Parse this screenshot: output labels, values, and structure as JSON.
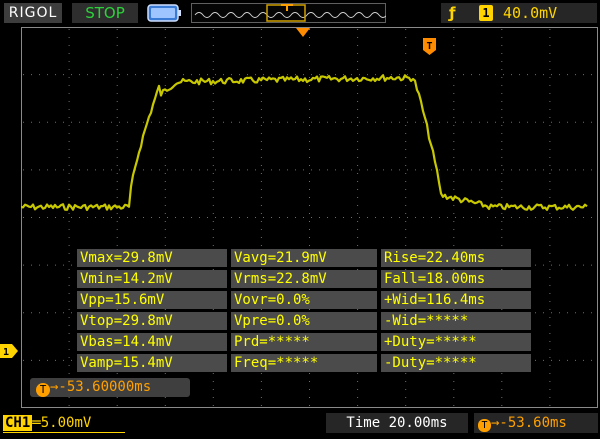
{
  "header": {
    "brand": "RIGOL",
    "run_status": "STOP",
    "trigger_edge_symbol": "ƒ",
    "trigger_channel": "1",
    "trigger_level": "40.0mV"
  },
  "markers": {
    "channel1_label": "1",
    "trigger_badge": "T"
  },
  "measurements": {
    "rows": [
      [
        "Vmax=29.8mV",
        "Vavg=21.9mV",
        "Rise=22.40ms"
      ],
      [
        "Vmin=14.2mV",
        "Vrms=22.8mV",
        "Fall=18.00ms"
      ],
      [
        "Vpp=15.6mV",
        "Vovr=0.0%",
        "+Wid=116.4ms"
      ],
      [
        "Vtop=29.8mV",
        "Vpre=0.0%",
        "-Wid=*****"
      ],
      [
        "Vbas=14.4mV",
        "Prd=*****",
        "+Duty=*****"
      ],
      [
        "Vamp=15.4mV",
        "Freq=*****",
        "-Duty=*****"
      ]
    ]
  },
  "trigger_offset": {
    "icon": "T",
    "value": "→-53.60000ms"
  },
  "footer": {
    "channel_tag": "CH1",
    "channel_coupling": "═",
    "channel_scale": "5.00mV",
    "timebase": "Time 20.00ms",
    "horizontal_offset_icon": "T",
    "horizontal_offset": "→-53.60ms"
  },
  "colors": {
    "trace": "#c8c800",
    "grid": "#8a8a8a",
    "accent_orange": "#ffa000",
    "status_green": "#2dd23b"
  }
}
